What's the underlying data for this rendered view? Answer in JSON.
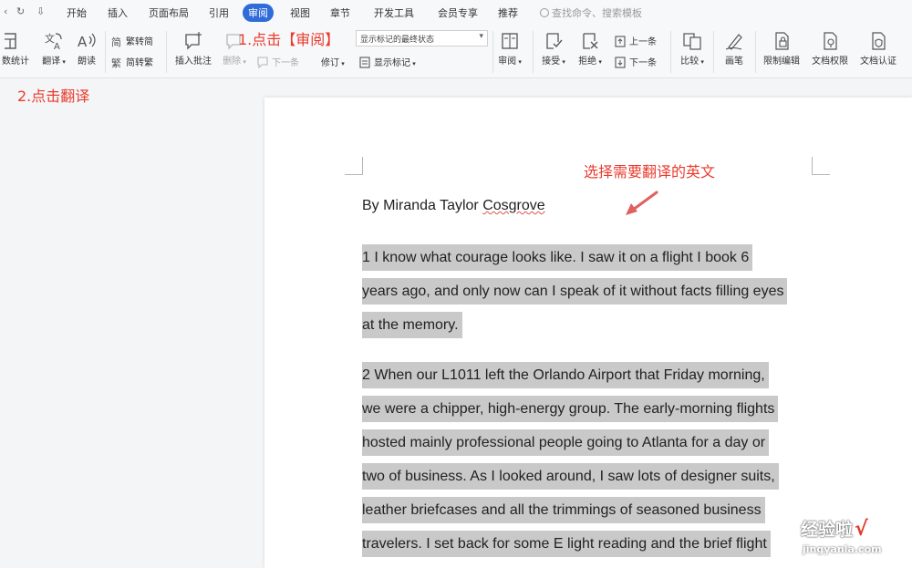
{
  "menubar": {
    "quick_access": [
      "‹",
      "↻",
      "⇩"
    ],
    "tabs": [
      {
        "label": "开始",
        "active": false
      },
      {
        "label": "插入",
        "active": false
      },
      {
        "label": "页面布局",
        "active": false
      },
      {
        "label": "引用",
        "active": false
      },
      {
        "label": "审阅",
        "active": true
      },
      {
        "label": "视图",
        "active": false
      },
      {
        "label": "章节",
        "active": false
      },
      {
        "label": "开发工具",
        "active": false
      },
      {
        "label": "会员专享",
        "active": false
      },
      {
        "label": "推荐",
        "active": false
      }
    ],
    "search_placeholder": "查找命令、搜索模板"
  },
  "ribbon": {
    "word_count": "数统计",
    "translate": "翻译",
    "read_aloud": "朗读",
    "trad_to_simp": "繁转简",
    "simp_to_trad": "简转繁",
    "insert_comment": "插入批注",
    "delete": "删除",
    "prev_comment": "上一条",
    "next_comment": "下一条",
    "markup_select": "显示标记的最终状态",
    "track_changes": "修订",
    "show_markup": "显示标记",
    "review": "审阅",
    "accept": "接受",
    "reject": "拒绝",
    "prev_change": "上一条",
    "next_change": "下一条",
    "compare": "比较",
    "ink": "画笔",
    "restrict_editing": "限制编辑",
    "doc_permission": "文档权限",
    "doc_certify": "文档认证"
  },
  "annotations": {
    "step1": "1.点击【审阅】",
    "step2": "2.点击翻译",
    "select_hint": "选择需要翻译的英文"
  },
  "document": {
    "author_prefix": "By Miranda Taylor ",
    "author_last": "Cosgrove",
    "paragraphs": [
      {
        "lines": [
          "1 I know what courage looks like. I saw it on a flight I book 6",
          "years ago, and only now can I speak of it without facts filling eyes",
          "at the memory."
        ]
      },
      {
        "lines": [
          "2 When our L1011 left the Orlando Airport that Friday morning,",
          "we were a chipper, high-energy group. The early-morning flights",
          "hosted mainly professional people going to Atlanta for a day or",
          "two of business. As I looked around, I saw lots of designer suits,",
          "leather briefcases and all the trimmings of seasoned business",
          "travelers. I set back for some E light reading and the brief flight"
        ]
      }
    ]
  },
  "watermark": {
    "brand": "经验啦",
    "url": "jingyanla.com"
  },
  "colors": {
    "accent": "#2f6bd9",
    "annotation": "#ea3b2d",
    "highlight": "#c9c9c9"
  }
}
